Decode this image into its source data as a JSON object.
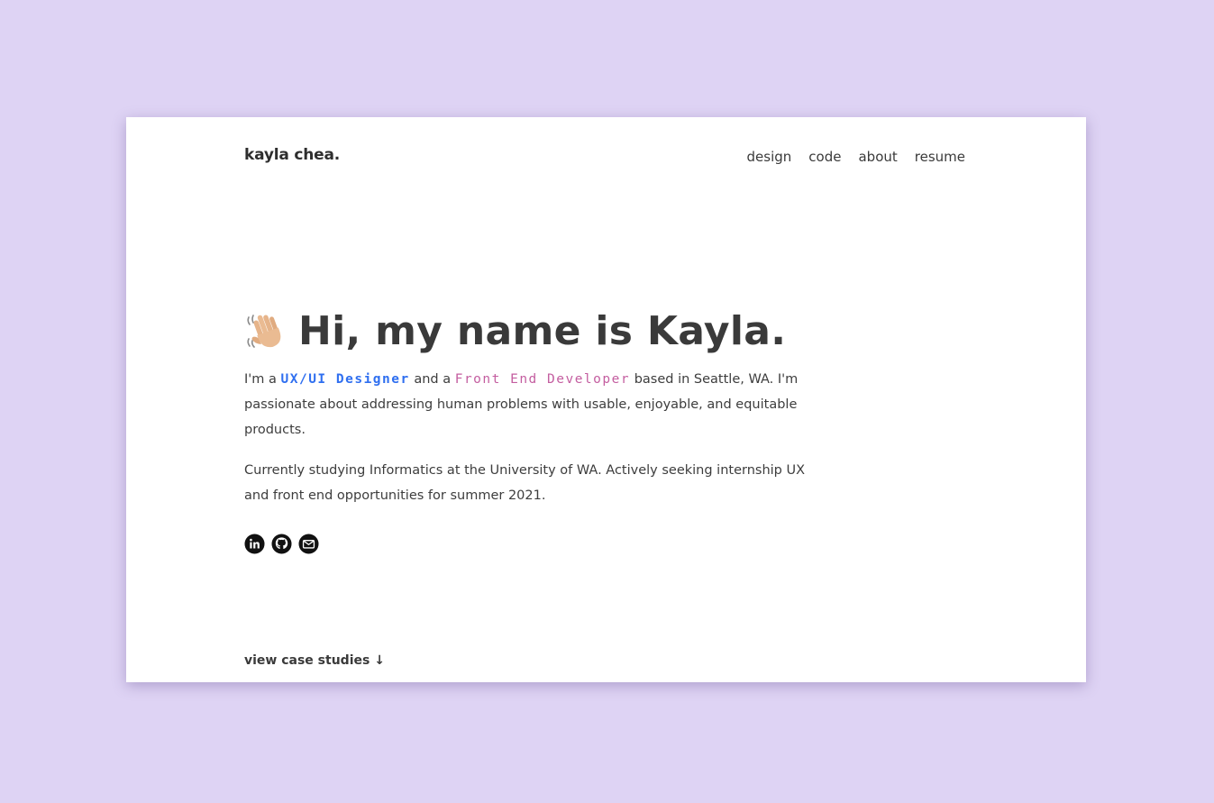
{
  "header": {
    "brand": "kayla chea.",
    "nav": [
      "design",
      "code",
      "about",
      "resume"
    ]
  },
  "hero": {
    "wave_icon": "waving-hand-icon",
    "headline": "Hi, my name is Kayla.",
    "intro_prefix": "I'm a ",
    "role_design": "UX/UI Designer",
    "intro_mid": " and a ",
    "role_dev": "Front End Developer",
    "intro_suffix": " based in Seattle, WA. I'm passionate about addressing human problems with usable, enjoyable, and equitable products.",
    "current": "Currently studying Informatics at the University of WA. Actively seeking internship UX and front end opportunities for summer 2021."
  },
  "socials": [
    "linkedin-icon",
    "github-icon",
    "mail-icon"
  ],
  "cta": "view case studies ↓",
  "colors": {
    "background": "#ded3f4",
    "design_role": "#2f6ff0",
    "dev_role": "#c45ea0",
    "text": "#3a3a3a"
  }
}
